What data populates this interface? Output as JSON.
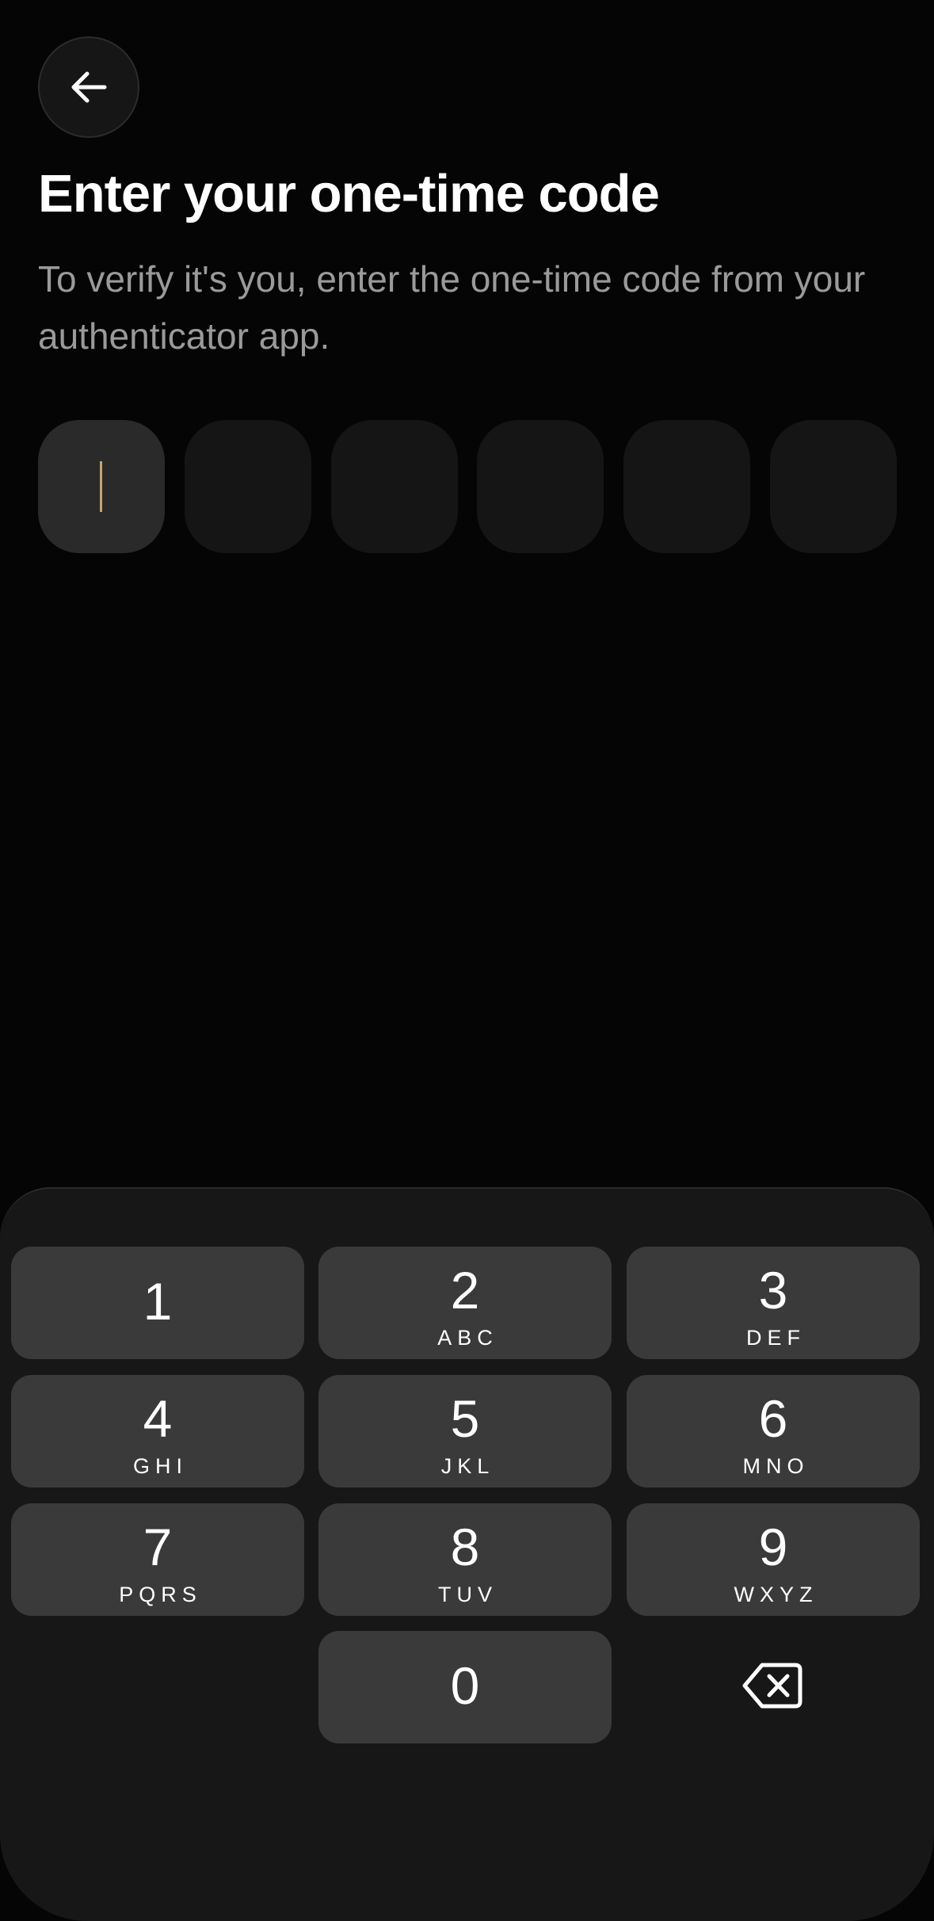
{
  "header": {
    "back_icon": "arrow-left-icon",
    "title": "Enter your one-time code",
    "subtitle": "To verify it's you, enter the one-time code from your authenticator app."
  },
  "otp": {
    "length": 6,
    "values": [
      "",
      "",
      "",
      "",
      "",
      ""
    ],
    "active_index": 0,
    "cursor_color": "#c9a46f"
  },
  "keypad": {
    "keys": [
      {
        "digit": "1",
        "letters": ""
      },
      {
        "digit": "2",
        "letters": "ABC"
      },
      {
        "digit": "3",
        "letters": "DEF"
      },
      {
        "digit": "4",
        "letters": "GHI"
      },
      {
        "digit": "5",
        "letters": "JKL"
      },
      {
        "digit": "6",
        "letters": "MNO"
      },
      {
        "digit": "7",
        "letters": "PQRS"
      },
      {
        "digit": "8",
        "letters": "TUV"
      },
      {
        "digit": "9",
        "letters": "WXYZ"
      },
      {
        "digit": "0",
        "letters": ""
      }
    ],
    "backspace_icon": "backspace-icon"
  },
  "colors": {
    "background": "#050505",
    "sheet": "#171717",
    "key": "#3a3a3a",
    "otp_box": "#151515",
    "otp_box_active": "#2a2a2a",
    "subtitle": "#9a9a9a"
  }
}
